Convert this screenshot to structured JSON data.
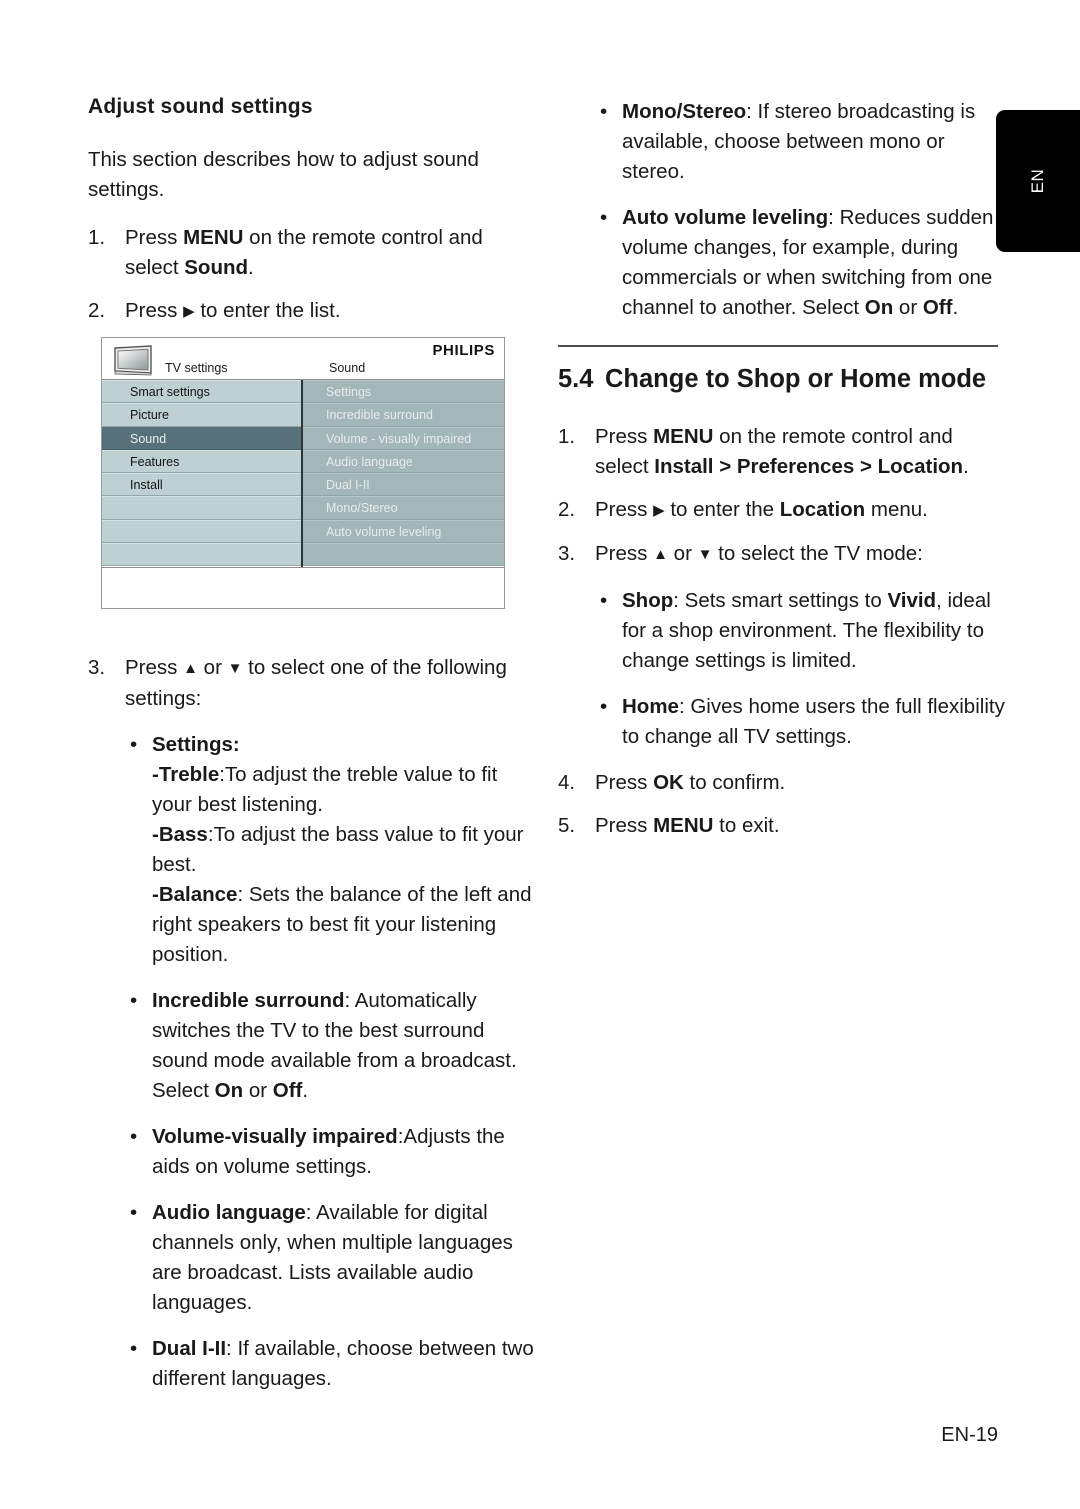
{
  "page": {
    "footer_label": "EN-19",
    "side_tab_label": "EN"
  },
  "left_column": {
    "heading": "Adjust sound settings",
    "intro": "This section describes how to adjust sound settings.",
    "steps": [
      {
        "num": "1.",
        "parts": [
          {
            "t": "Press ",
            "b": false
          },
          {
            "t": "MENU",
            "b": true
          },
          {
            "t": " on the remote control and select ",
            "b": false
          },
          {
            "t": "Sound",
            "b": true
          },
          {
            "t": ".",
            "b": false
          }
        ]
      },
      {
        "num": "2.",
        "parts": [
          {
            "t": "Press ",
            "b": false
          },
          {
            "t": "▶",
            "b": false,
            "glyph": true
          },
          {
            "t": " to enter the list.",
            "b": false
          }
        ]
      }
    ],
    "step3": {
      "num": "3.",
      "parts": [
        {
          "t": "Press ",
          "b": false
        },
        {
          "t": "▲",
          "b": false,
          "glyph": true
        },
        {
          "t": " or ",
          "b": false
        },
        {
          "t": "▼",
          "b": false,
          "glyph": true
        },
        {
          "t": " to select one of the following settings:",
          "b": false
        }
      ]
    },
    "bullets": [
      {
        "name": "settings",
        "parts": [
          {
            "t": "Settings:",
            "b": true
          }
        ],
        "sublines": [
          [
            {
              "t": "-Treble",
              "b": true
            },
            {
              "t": ":To adjust the treble value to fit your best listening.",
              "b": false
            }
          ],
          [
            {
              "t": "-Bass",
              "b": true
            },
            {
              "t": ":To adjust the bass value to fit your best.",
              "b": false
            }
          ],
          [
            {
              "t": "-Balance",
              "b": true
            },
            {
              "t": ": Sets the balance of the left and right speakers to best fit your listening position.",
              "b": false
            }
          ]
        ]
      },
      {
        "name": "incredible-surround",
        "parts": [
          {
            "t": "Incredible surround",
            "b": true
          },
          {
            "t": ": Automatically switches the TV to the best surround sound mode available from a broadcast. Select ",
            "b": false
          },
          {
            "t": "On",
            "b": true
          },
          {
            "t": " or ",
            "b": false
          },
          {
            "t": "Off",
            "b": true
          },
          {
            "t": ".",
            "b": false
          }
        ],
        "sublines": []
      },
      {
        "name": "volume-visually-impaired",
        "parts": [
          {
            "t": "Volume-visually impaired",
            "b": true
          },
          {
            "t": ":Adjusts the aids on volume settings.",
            "b": false
          }
        ],
        "sublines": []
      },
      {
        "name": "audio-language",
        "parts": [
          {
            "t": "Audio language",
            "b": true
          },
          {
            "t": ": Available for digital channels only, when multiple languages are broadcast. Lists available audio languages.",
            "b": false
          }
        ],
        "sublines": []
      },
      {
        "name": "dual-i-ii",
        "parts": [
          {
            "t": "Dual I-II",
            "b": true
          },
          {
            "t": ": If available, choose between two different languages.",
            "b": false
          }
        ],
        "sublines": []
      }
    ]
  },
  "tv_menu": {
    "brand": "PHILIPS",
    "left_header": "TV settings",
    "right_header": "Sound",
    "left_items": [
      {
        "label": "Smart settings",
        "selected": false
      },
      {
        "label": "Picture",
        "selected": false
      },
      {
        "label": "Sound",
        "selected": true
      },
      {
        "label": "Features",
        "selected": false
      },
      {
        "label": "Install",
        "selected": false
      },
      {
        "label": "",
        "selected": false
      },
      {
        "label": "",
        "selected": false
      },
      {
        "label": "",
        "selected": false
      }
    ],
    "right_items": [
      {
        "label": "Settings"
      },
      {
        "label": "Incredible surround"
      },
      {
        "label": "Volume - visually impaired"
      },
      {
        "label": "Audio language"
      },
      {
        "label": "Dual I-II"
      },
      {
        "label": "Mono/Stereo"
      },
      {
        "label": "Auto volume leveling"
      },
      {
        "label": ""
      }
    ],
    "colors": {
      "left_item_bg": "#bfd0d2",
      "left_item_selected_bg": "#56717a",
      "right_item_bg": "#a3b6b8",
      "divider": "#2d3538"
    }
  },
  "right_column": {
    "top_bullets": [
      {
        "name": "mono-stereo",
        "parts": [
          {
            "t": "Mono/Stereo",
            "b": true
          },
          {
            "t": ": If stereo broadcasting is available, choose between mono or stereo.",
            "b": false
          }
        ]
      },
      {
        "name": "auto-volume-leveling",
        "parts": [
          {
            "t": "Auto volume leveling",
            "b": true
          },
          {
            "t": ": Reduces sudden volume changes, for example, during commercials or when switching from one channel to another. Select ",
            "b": false
          },
          {
            "t": "On",
            "b": true
          },
          {
            "t": " or ",
            "b": false
          },
          {
            "t": "Off",
            "b": true
          },
          {
            "t": ".",
            "b": false
          }
        ]
      }
    ],
    "section": {
      "number": "5.4",
      "title": "Change to Shop or Home mode",
      "steps": [
        {
          "num": "1.",
          "parts": [
            {
              "t": "Press ",
              "b": false
            },
            {
              "t": "MENU",
              "b": true
            },
            {
              "t": " on the remote control and select ",
              "b": false
            },
            {
              "t": "Install",
              "b": true
            },
            {
              "t": " > ",
              "b": true
            },
            {
              "t": "Preferences",
              "b": true
            },
            {
              "t": " > ",
              "b": true
            },
            {
              "t": "Location",
              "b": true
            },
            {
              "t": ".",
              "b": false
            }
          ]
        },
        {
          "num": "2.",
          "parts": [
            {
              "t": "Press ",
              "b": false
            },
            {
              "t": "▶",
              "b": false,
              "glyph": true
            },
            {
              "t": " to enter the ",
              "b": false
            },
            {
              "t": "Location",
              "b": true
            },
            {
              "t": " menu.",
              "b": false
            }
          ]
        },
        {
          "num": "3.",
          "parts": [
            {
              "t": "Press ",
              "b": false
            },
            {
              "t": "▲",
              "b": false,
              "glyph": true
            },
            {
              "t": " or ",
              "b": false
            },
            {
              "t": "▼",
              "b": false,
              "glyph": true
            },
            {
              "t": " to select the TV mode:",
              "b": false
            }
          ]
        }
      ],
      "mode_bullets": [
        {
          "name": "shop",
          "parts": [
            {
              "t": "Shop",
              "b": true
            },
            {
              "t": ": Sets smart settings to ",
              "b": false
            },
            {
              "t": "Vivid",
              "b": true
            },
            {
              "t": ", ideal for a shop environment. The flexibility to change settings is limited.",
              "b": false
            }
          ]
        },
        {
          "name": "home",
          "parts": [
            {
              "t": "Home",
              "b": true
            },
            {
              "t": ": Gives home users the full flexibility to change all TV settings.",
              "b": false
            }
          ]
        }
      ],
      "steps_after": [
        {
          "num": "4.",
          "parts": [
            {
              "t": "Press ",
              "b": false
            },
            {
              "t": "OK",
              "b": true
            },
            {
              "t": " to confirm.",
              "b": false
            }
          ]
        },
        {
          "num": "5.",
          "parts": [
            {
              "t": "Press ",
              "b": false
            },
            {
              "t": "MENU",
              "b": true
            },
            {
              "t": " to exit.",
              "b": false
            }
          ]
        }
      ]
    }
  }
}
